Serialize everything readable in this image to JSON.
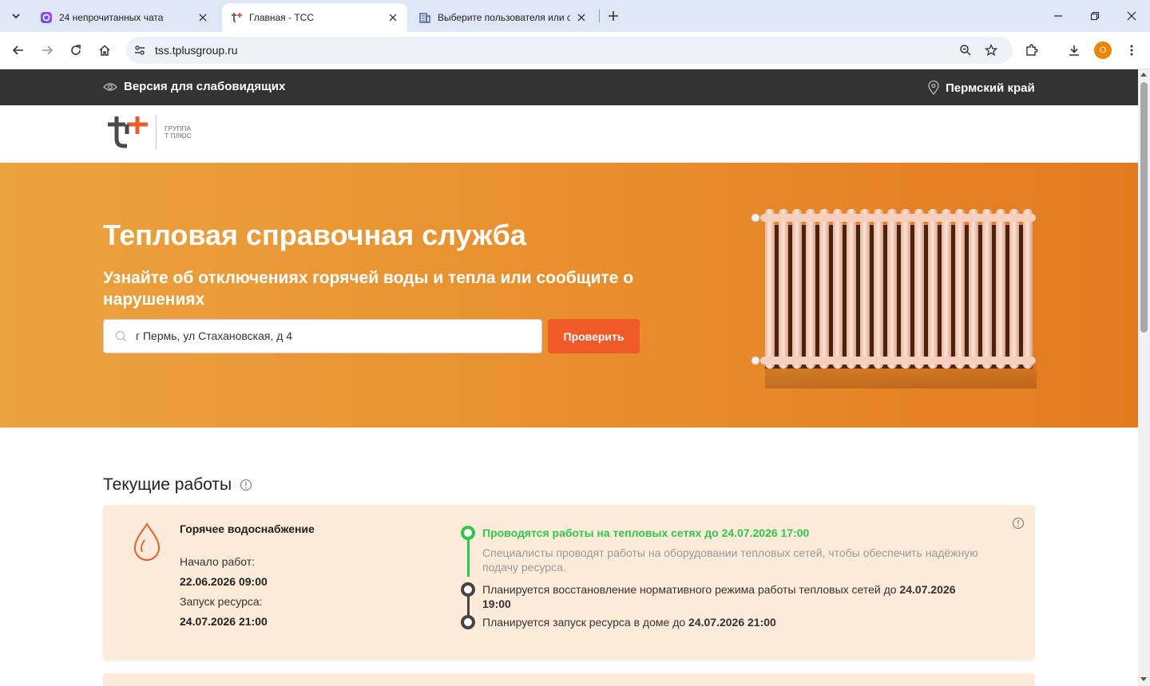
{
  "browser": {
    "tabs": [
      {
        "title": "24 непрочитанных чата",
        "active": false
      },
      {
        "title": "Главная - ТСС",
        "active": true
      },
      {
        "title": "Выберите пользователя или создайте",
        "active": false
      }
    ],
    "url": "tss.tplusgroup.ru",
    "profile_initial": "O"
  },
  "topbar": {
    "vision_label": "Версия для слабовидящих",
    "region": "Пермский край"
  },
  "logo": {
    "line1": "ГРУППА",
    "line2": "Т ПЛЮС"
  },
  "hero": {
    "title": "Тепловая справочная служба",
    "subtitle": "Узнайте об отключениях горячей воды и тепла или сообщите о нарушениях",
    "search_value": "г Пермь, ул Стахановская, д 4",
    "button": "Проверить"
  },
  "works": {
    "section_title": "Текущие работы",
    "card": {
      "service": "Горячее водоснабжение",
      "start_label": "Начало работ:",
      "start_value": "22.06.2026 09:00",
      "launch_label": "Запуск ресурса:",
      "launch_value": "24.07.2026 21:00",
      "timeline": [
        {
          "text": "Проводятся работы на тепловых сетях до",
          "date": "24.07.2026 17:00",
          "status": "active",
          "note": "Специалисты проводят работы на оборудовании тепловых сетей, чтобы обеспечить надёжную подачу ресурса."
        },
        {
          "text": "Планируется восстановление нормативного режима работы тепловых сетей до",
          "date": "24.07.2026",
          "date_cont": "19:00",
          "status": "planned"
        },
        {
          "text": "Планируется запуск ресурса в доме до",
          "date": "24.07.2026 21:00",
          "status": "planned"
        }
      ]
    }
  },
  "colors": {
    "accent": "#f05a28",
    "hero_start": "#eba33e",
    "hero_end": "#e27b1f",
    "card_bg": "#fdebd9",
    "active_green": "#2ec84a",
    "topbar": "#333333"
  }
}
